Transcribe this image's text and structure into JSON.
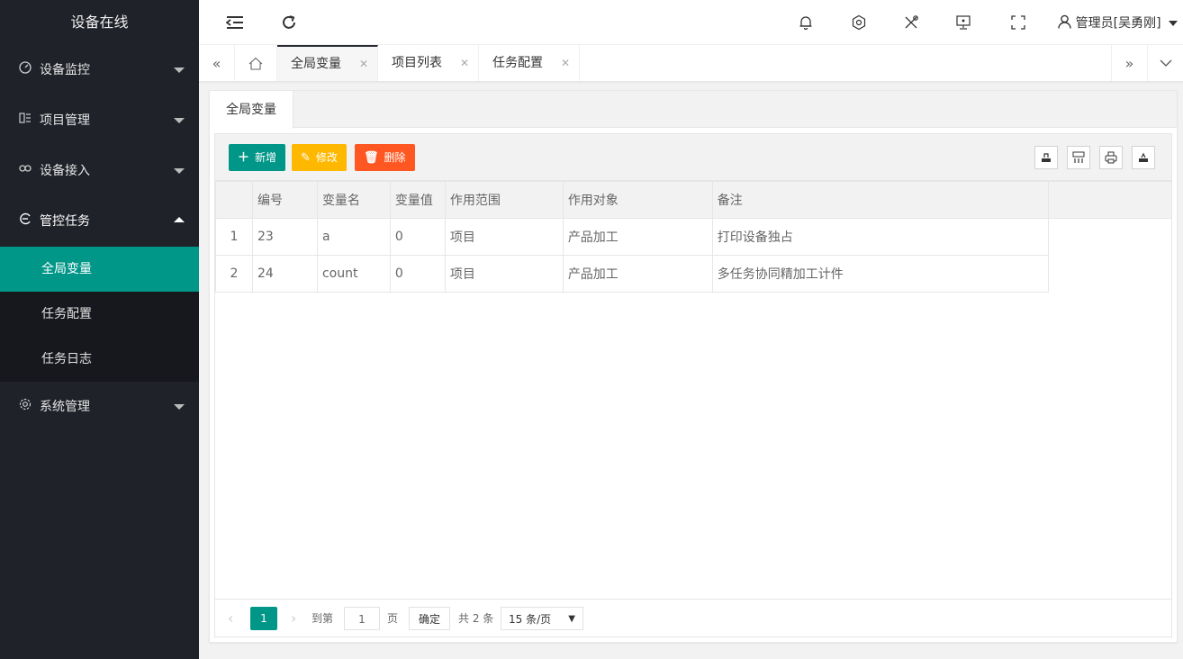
{
  "sidebar": {
    "logo": "设备在线",
    "menu": [
      {
        "label": "设备监控",
        "icon": "gauge-icon"
      },
      {
        "label": "项目管理",
        "icon": "project-icon"
      },
      {
        "label": "设备接入",
        "icon": "link-icon"
      },
      {
        "label": "管控任务",
        "icon": "task-icon"
      },
      {
        "label": "系统管理",
        "icon": "gear-icon"
      }
    ],
    "submenu": [
      "全局变量",
      "任务配置",
      "任务日志"
    ]
  },
  "header": {
    "user": "管理员[吴勇刚]"
  },
  "page_tabs": [
    {
      "label": "全局变量",
      "active": true
    },
    {
      "label": "项目列表",
      "active": false
    },
    {
      "label": "任务配置",
      "active": false
    }
  ],
  "card": {
    "tab": "全局变量"
  },
  "toolbar": {
    "add": "新增",
    "edit": "修改",
    "delete": "删除"
  },
  "colors": {
    "add": "#009688",
    "edit": "#ffb800",
    "delete": "#ff5722",
    "active": "#009688"
  },
  "table": {
    "columns": [
      "编号",
      "变量名",
      "变量值",
      "作用范围",
      "作用对象",
      "备注"
    ],
    "rows": [
      {
        "index": "1",
        "id": "23",
        "name": "a",
        "value": "0",
        "scope": "项目",
        "target": "产品加工",
        "remark": "打印设备独占"
      },
      {
        "index": "2",
        "id": "24",
        "name": "count",
        "value": "0",
        "scope": "项目",
        "target": "产品加工",
        "remark": "多任务协同精加工计件"
      }
    ]
  },
  "pager": {
    "current": "1",
    "goto_label": "到第",
    "page_input": "1",
    "page_unit": "页",
    "confirm": "确定",
    "total": "共 2 条",
    "page_size": "15 条/页"
  }
}
